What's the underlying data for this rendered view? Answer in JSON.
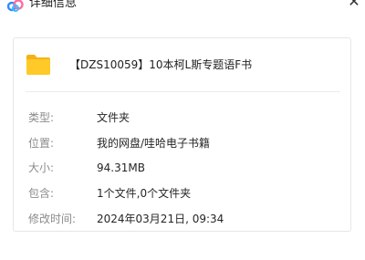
{
  "window": {
    "title": "详细信息",
    "icon": "cloud-logo-icon",
    "close_icon": "close-icon"
  },
  "file": {
    "icon": "folder-icon",
    "name": "【DZS10059】10本柯L斯专题语F书"
  },
  "details": [
    {
      "label": "类型:",
      "value": "文件夹"
    },
    {
      "label": "位置:",
      "value": "我的网盘/哇哈电子书籍"
    },
    {
      "label": "大小:",
      "value": "94.31MB"
    },
    {
      "label": "包含:",
      "value": "1个文件,0个文件夹"
    },
    {
      "label": "修改时间:",
      "value": "2024年03月21日, 09:34"
    }
  ],
  "colors": {
    "folder": "#FFC928",
    "folder_tab": "#F5B215",
    "logo_blue": "#2F8BFF",
    "logo_pink": "#FF6BA6",
    "label": "#8b8b8b",
    "value": "#262626"
  }
}
